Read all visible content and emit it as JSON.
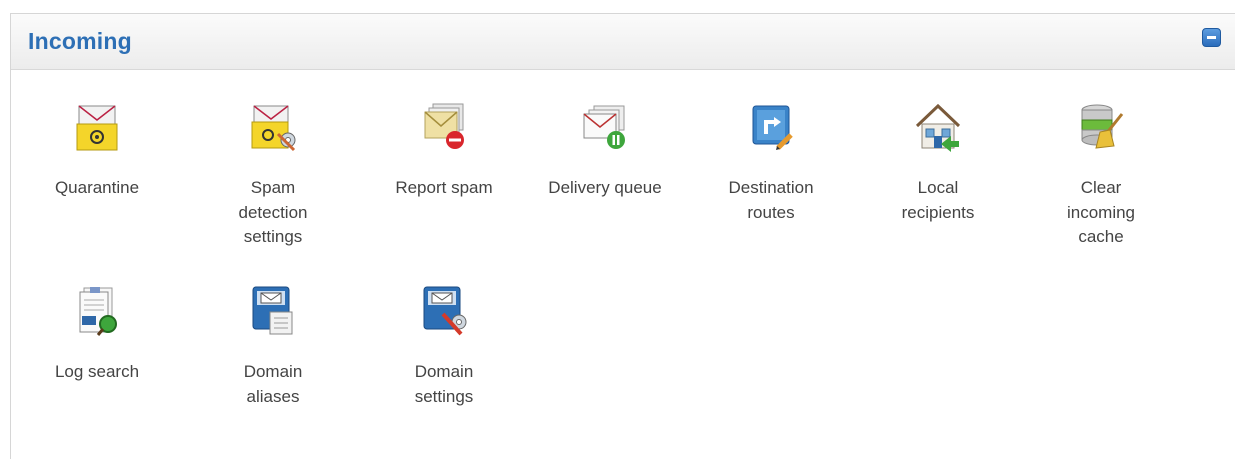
{
  "panel": {
    "title": "Incoming",
    "accent_color": "#2d6fb5"
  },
  "items": [
    {
      "label": "Quarantine",
      "icon": "quarantine-icon"
    },
    {
      "label": "Spam\ndetection\nsettings",
      "icon": "spam-settings-icon"
    },
    {
      "label": "Report spam",
      "icon": "report-spam-icon"
    },
    {
      "label": "Delivery queue",
      "icon": "delivery-queue-icon"
    },
    {
      "label": "Destination\nroutes",
      "icon": "destination-routes-icon"
    },
    {
      "label": "Local\nrecipients",
      "icon": "local-recipients-icon"
    },
    {
      "label": "Clear\nincoming\ncache",
      "icon": "clear-cache-icon"
    },
    {
      "label": "Log search",
      "icon": "log-search-icon"
    },
    {
      "label": "Domain\naliases",
      "icon": "domain-aliases-icon"
    },
    {
      "label": "Domain\nsettings",
      "icon": "domain-settings-icon"
    }
  ]
}
